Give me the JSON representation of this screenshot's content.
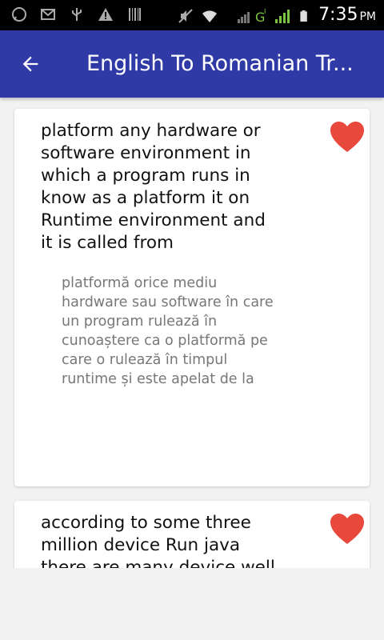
{
  "status_bar": {
    "time": "7:35",
    "ampm": "PM",
    "network": "G",
    "network_sup": "R"
  },
  "app_bar": {
    "title": "English To Romanian Tr...",
    "back_icon": "arrow-left-icon",
    "background": "#2f3aa7"
  },
  "cards": [
    {
      "english": "platform any hardware or software environment in which a program runs in know as a platform it on Runtime environment and it is called from",
      "romanian": "platformă orice mediu hardware sau software în care un program rulează în cunoaștere ca o platformă pe care o rulează în timpul runtime și este apelat de la",
      "favorite_icon": "heart-icon",
      "favorite_color": "#e8493c"
    },
    {
      "english": "according to some three million device Run java there are many device well",
      "favorite_icon": "heart-icon",
      "favorite_color": "#e8493c"
    }
  ]
}
